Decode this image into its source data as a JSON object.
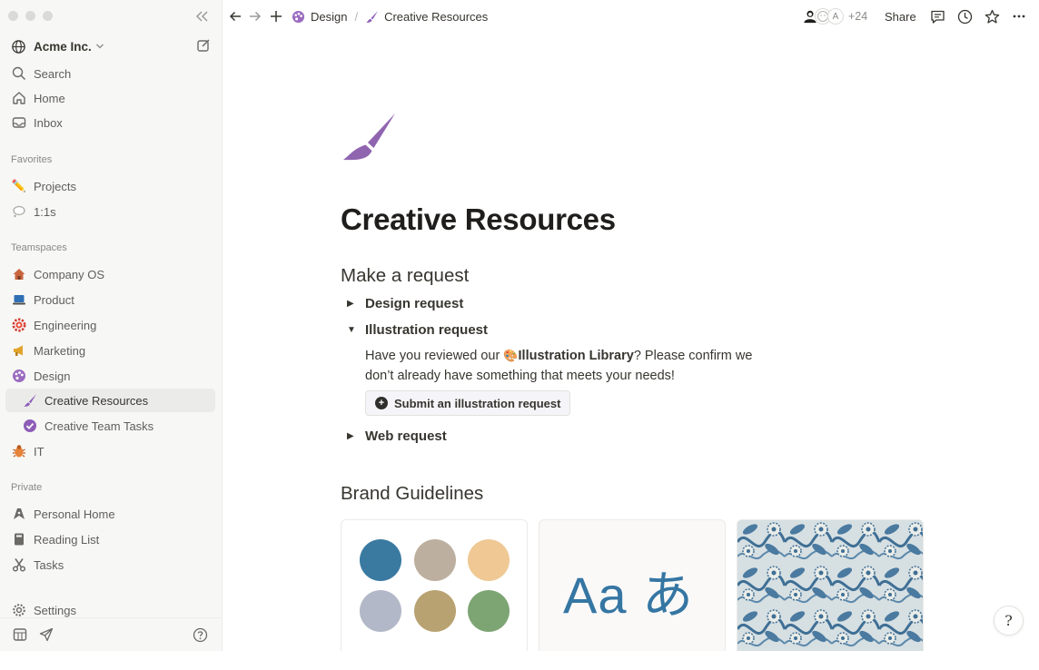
{
  "workspace": {
    "name": "Acme Inc."
  },
  "sidebar": {
    "top_items": [
      {
        "label": "Search",
        "icon": "search-icon"
      },
      {
        "label": "Home",
        "icon": "home-icon"
      },
      {
        "label": "Inbox",
        "icon": "inbox-icon"
      }
    ],
    "favorites_label": "Favorites",
    "favorites": [
      {
        "label": "Projects",
        "icon": "pencil-icon",
        "emoji": "✏️"
      },
      {
        "label": "1:1s",
        "icon": "speech-bubble-icon",
        "emoji": "💭"
      }
    ],
    "teamspaces_label": "Teamspaces",
    "teamspaces": [
      {
        "label": "Company OS",
        "icon": "house-icon",
        "emoji": "🏠"
      },
      {
        "label": "Product",
        "icon": "laptop-icon",
        "emoji": "💻"
      },
      {
        "label": "Engineering",
        "icon": "gear-icon",
        "emoji": "⚙"
      },
      {
        "label": "Marketing",
        "icon": "megaphone-icon",
        "emoji": "📢"
      },
      {
        "label": "Design",
        "icon": "palette-icon",
        "emoji": "🎨"
      },
      {
        "label": "Creative Resources",
        "icon": "paintbrush-icon"
      },
      {
        "label": "Creative Team Tasks",
        "icon": "check-circle-icon"
      },
      {
        "label": "IT",
        "icon": "bug-icon",
        "emoji": "🐞"
      }
    ],
    "private_label": "Private",
    "private": [
      {
        "label": "Personal Home",
        "icon": "pen-nib-icon"
      },
      {
        "label": "Reading List",
        "icon": "book-icon"
      },
      {
        "label": "Tasks",
        "icon": "scissors-icon"
      }
    ],
    "settings_label": "Settings"
  },
  "topbar": {
    "breadcrumbs": [
      {
        "label": "Design",
        "icon": "palette-icon"
      },
      {
        "label": "Creative Resources",
        "icon": "paintbrush-icon"
      }
    ],
    "breadcrumb_separator": "/",
    "avatar_letter": "A",
    "avatar_count": "+24",
    "share_label": "Share"
  },
  "page": {
    "title": "Creative Resources",
    "icon": "paintbrush-icon",
    "icon_color": "#9065b0",
    "section1_heading": "Make a request",
    "toggles": [
      {
        "label": "Design request",
        "open": false
      },
      {
        "label": "Illustration request",
        "open": true
      },
      {
        "label": "Web request",
        "open": false
      }
    ],
    "illustration_body": {
      "before": "Have you reviewed our ",
      "link": "Illustration Library",
      "after": "? Please confirm we don’t already have something that meets your needs!"
    },
    "cta_label": "Submit an illustration request",
    "section2_heading": "Brand Guidelines",
    "swatches": [
      "#3a7aa1",
      "#bdaf9f",
      "#efc894",
      "#b3b8c8",
      "#b9a271",
      "#7da574"
    ],
    "type_sample": "Aa あ"
  },
  "help_glyph": "?"
}
